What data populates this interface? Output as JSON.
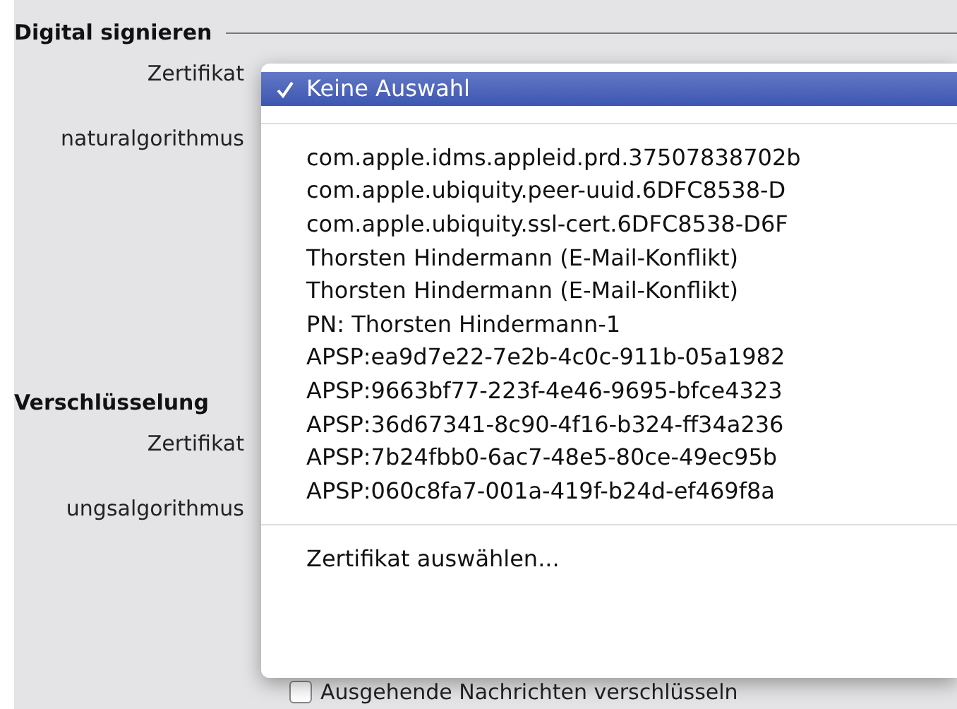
{
  "sections": [
    {
      "title": "Digital signieren",
      "rows": [
        {
          "label": "Zertifikat"
        },
        {
          "label": "naturalgorithmus"
        }
      ]
    },
    {
      "title": "Verschlüsselung",
      "rows": [
        {
          "label": "Zertifikat"
        },
        {
          "label": "ungsalgorithmus"
        }
      ]
    }
  ],
  "checkbox": {
    "label": "Ausgehende Nachrichten verschlüsseln",
    "checked": false
  },
  "menu": {
    "items": [
      {
        "kind": "item",
        "label": "Keine Auswahl",
        "selected": true
      },
      {
        "kind": "separator"
      },
      {
        "kind": "item",
        "label": "com.apple.idms.appleid.prd.37507838702b",
        "selected": false
      },
      {
        "kind": "item",
        "label": "com.apple.ubiquity.peer-uuid.6DFC8538-D",
        "selected": false
      },
      {
        "kind": "item",
        "label": "com.apple.ubiquity.ssl-cert.6DFC8538-D6F",
        "selected": false
      },
      {
        "kind": "item",
        "label": "Thorsten Hindermann (E-Mail-Konflikt)",
        "selected": false
      },
      {
        "kind": "item",
        "label": "Thorsten Hindermann (E-Mail-Konflikt)",
        "selected": false
      },
      {
        "kind": "item",
        "label": "PN: Thorsten Hindermann-1",
        "selected": false
      },
      {
        "kind": "item",
        "label": "APSP:ea9d7e22-7e2b-4c0c-911b-05a1982",
        "selected": false
      },
      {
        "kind": "item",
        "label": "APSP:9663bf77-223f-4e46-9695-bfce4323",
        "selected": false
      },
      {
        "kind": "item",
        "label": "APSP:36d67341-8c90-4f16-b324-ff34a236",
        "selected": false
      },
      {
        "kind": "item",
        "label": "APSP:7b24fbb0-6ac7-48e5-80ce-49ec95b",
        "selected": false
      },
      {
        "kind": "item",
        "label": "APSP:060c8fa7-001a-419f-b24d-ef469f8a",
        "selected": false
      },
      {
        "kind": "separator"
      },
      {
        "kind": "item",
        "label": "Zertifikat auswählen...",
        "selected": false
      }
    ]
  }
}
